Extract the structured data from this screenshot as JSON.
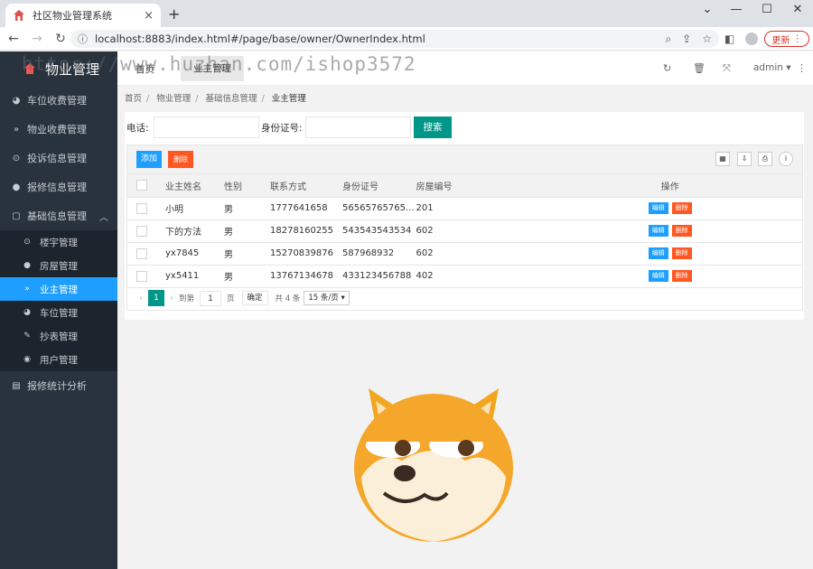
{
  "browser": {
    "tab_title": "社区物业管理系统",
    "tab_close": "×",
    "new_tab": "+",
    "url": "localhost:8883/index.html#/page/base/owner/OwnerIndex.html",
    "update_label": "更新",
    "window_controls": [
      "⌄",
      "—",
      "☐",
      "✕"
    ]
  },
  "app": {
    "logo_text": "物业管理",
    "watermark": "https://www.huzhan.com/ishop3572",
    "header_tabs": [
      "首页",
      "业主管理"
    ],
    "admin_label": "admin ▾",
    "header_icons": [
      "refresh-icon",
      "trash-icon",
      "fullscreen-icon",
      "more-icon"
    ]
  },
  "sidebar": {
    "items": [
      {
        "label": "车位收费管理",
        "icon": "dashboard-icon"
      },
      {
        "label": "物业收费管理",
        "icon": "chevron-icon"
      },
      {
        "label": "投诉信息管理",
        "icon": "target-icon"
      },
      {
        "label": "报修信息管理",
        "icon": "circle-icon"
      },
      {
        "label": "基础信息管理",
        "icon": "square-icon",
        "expanded": true
      }
    ],
    "subitems": [
      {
        "label": "楼宇管理",
        "icon": "target-icon"
      },
      {
        "label": "房屋管理",
        "icon": "circle-icon"
      },
      {
        "label": "业主管理",
        "icon": "chevron-icon",
        "active": true
      },
      {
        "label": "车位管理",
        "icon": "dashboard-icon"
      },
      {
        "label": "抄表管理",
        "icon": "edit-icon"
      },
      {
        "label": "用户管理",
        "icon": "user-icon"
      }
    ],
    "last_item": {
      "label": "报修统计分析",
      "icon": "chart-icon"
    }
  },
  "breadcrumb": [
    "首页",
    "物业管理",
    "基础信息管理",
    "业主管理"
  ],
  "search": {
    "phone_label": "电话:",
    "idcard_label": "身份证号:",
    "button_label": "搜索"
  },
  "toolbar": {
    "add_label": "添加",
    "delete_label": "删除",
    "tool_icons": [
      "filter-icon",
      "export-icon",
      "print-icon",
      "info-icon"
    ]
  },
  "table": {
    "headers": [
      "业主姓名",
      "性别",
      "联系方式",
      "身份证号",
      "房屋编号",
      "操作"
    ],
    "rows": [
      {
        "name": "小明",
        "gender": "男",
        "phone": "1777641658",
        "idcard": "56565765765...",
        "house": "201"
      },
      {
        "name": "下的方法",
        "gender": "男",
        "phone": "18278160255",
        "idcard": "543543543534",
        "house": "602"
      },
      {
        "name": "yx7845",
        "gender": "男",
        "phone": "15270839876",
        "idcard": "587968932",
        "house": "602"
      },
      {
        "name": "yx5411",
        "gender": "男",
        "phone": "13767134678",
        "idcard": "433123456788",
        "house": "402"
      }
    ],
    "edit_label": "编辑",
    "remove_label": "删除"
  },
  "pager": {
    "current": "1",
    "goto_label": "到第",
    "page_input": "1",
    "page_unit": "页",
    "confirm": "确定",
    "total": "共 4 条",
    "page_size": "15 条/页 ▾"
  }
}
